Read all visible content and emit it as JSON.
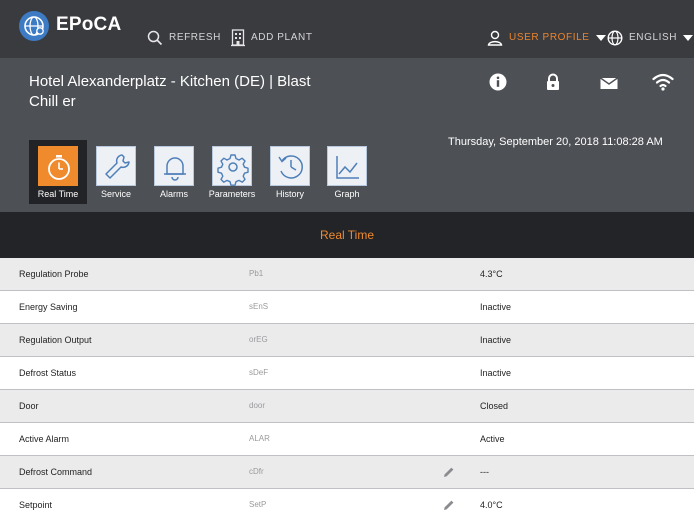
{
  "topbar": {
    "app_name": "EPoCA",
    "refresh_label": "REFRESH",
    "add_plant_label": "ADD PLANT",
    "user_profile_label": "USER PROFILE",
    "language_label": "ENGLISH",
    "accent_color": "#e9842d"
  },
  "header": {
    "plant_title": "Hotel Alexanderplatz - Kitchen (DE) | Blast Chill er",
    "datetime": "Thursday, September 20, 2018 11:08:28 AM",
    "status_icons": [
      "info-icon",
      "lock-icon",
      "mail-icon",
      "wifi-icon"
    ]
  },
  "nav": {
    "tabs": [
      {
        "label": "Real Time",
        "icon": "stopwatch-icon",
        "active": true
      },
      {
        "label": "Service",
        "icon": "wrench-icon",
        "active": false
      },
      {
        "label": "Alarms",
        "icon": "bell-icon",
        "active": false
      },
      {
        "label": "Parameters",
        "icon": "gear-icon",
        "active": false
      },
      {
        "label": "History",
        "icon": "history-icon",
        "active": false
      },
      {
        "label": "Graph",
        "icon": "graph-icon",
        "active": false
      }
    ]
  },
  "section": {
    "title": "Real Time"
  },
  "table": {
    "rows": [
      {
        "name": "Regulation Probe",
        "code": "Pb1",
        "value": "4.3°C",
        "editable": false
      },
      {
        "name": "Energy Saving",
        "code": "sEnS",
        "value": "Inactive",
        "editable": false
      },
      {
        "name": "Regulation Output",
        "code": "orEG",
        "value": "Inactive",
        "editable": false
      },
      {
        "name": "Defrost Status",
        "code": "sDeF",
        "value": "Inactive",
        "editable": false
      },
      {
        "name": "Door",
        "code": "door",
        "value": "Closed",
        "editable": false
      },
      {
        "name": "Active Alarm",
        "code": "ALAR",
        "value": "Active",
        "editable": false
      },
      {
        "name": "Defrost Command",
        "code": "cDfr",
        "value": "---",
        "editable": true
      },
      {
        "name": "Setpoint",
        "code": "SetP",
        "value": "4.0°C",
        "editable": true
      }
    ]
  }
}
